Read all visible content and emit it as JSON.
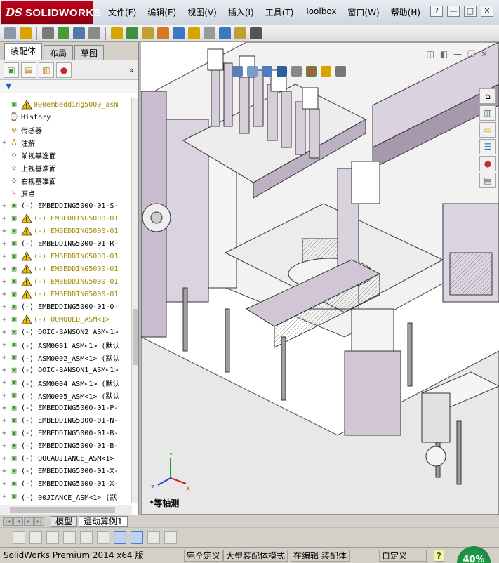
{
  "app": {
    "logo_mark": "DS",
    "logo_text": "SOLIDWORKS"
  },
  "menu": [
    "文件(F)",
    "编辑(E)",
    "视图(V)",
    "插入(I)",
    "工具(T)",
    "Toolbox",
    "窗口(W)",
    "帮助(H)"
  ],
  "window_controls": {
    "help": "?",
    "min": "—",
    "max": "□",
    "close": "✕"
  },
  "panel": {
    "tabs": [
      "装配体",
      "布局",
      "草图"
    ],
    "active_tab": "装配体",
    "filter_icon": "▼"
  },
  "tree": [
    {
      "exp": "",
      "icon": "assembly",
      "warn": true,
      "label": "000embedding5000_asm",
      "yellow": true
    },
    {
      "exp": "",
      "icon": "history",
      "warn": false,
      "label": "History",
      "yellow": false
    },
    {
      "exp": "",
      "icon": "sensor",
      "warn": false,
      "label": "传感器",
      "yellow": false
    },
    {
      "exp": "+",
      "icon": "annotation",
      "warn": false,
      "label": "注解",
      "yellow": false
    },
    {
      "exp": "",
      "icon": "plane",
      "warn": false,
      "label": "前视基准面",
      "yellow": false
    },
    {
      "exp": "",
      "icon": "plane",
      "warn": false,
      "label": "上视基准面",
      "yellow": false
    },
    {
      "exp": "",
      "icon": "plane",
      "warn": false,
      "label": "右视基准面",
      "yellow": false
    },
    {
      "exp": "",
      "icon": "origin",
      "warn": false,
      "label": "原点",
      "yellow": false
    },
    {
      "exp": "+",
      "icon": "assembly",
      "warn": false,
      "label": "(-) EMBEDDING5000-01-S-",
      "yellow": false
    },
    {
      "exp": "+",
      "icon": "assembly",
      "warn": true,
      "label": "(-) EMBEDDING5000-01",
      "yellow": true
    },
    {
      "exp": "+",
      "icon": "assembly",
      "warn": true,
      "label": "(-) EMBEDDING5000-01",
      "yellow": true
    },
    {
      "exp": "+",
      "icon": "assembly",
      "warn": false,
      "label": "(-) EMBEDDING5000-01-R-",
      "yellow": false
    },
    {
      "exp": "+",
      "icon": "assembly",
      "warn": true,
      "label": "(-) EMBEDDING5000-01",
      "yellow": true
    },
    {
      "exp": "+",
      "icon": "assembly",
      "warn": true,
      "label": "(-) EMBEDDING5000-01",
      "yellow": true
    },
    {
      "exp": "+",
      "icon": "assembly",
      "warn": true,
      "label": "(-) EMBEDDING5000-01",
      "yellow": true
    },
    {
      "exp": "+",
      "icon": "assembly",
      "warn": true,
      "label": "(-) EMBEDDING5000-01",
      "yellow": true
    },
    {
      "exp": "+",
      "icon": "assembly",
      "warn": false,
      "label": "(-) EMBEDDING5000-01-0-",
      "yellow": false
    },
    {
      "exp": "+",
      "icon": "assembly",
      "warn": true,
      "label": "(-) 00MOULD_ASM<1>",
      "yellow": true
    },
    {
      "exp": "+",
      "icon": "assembly",
      "warn": false,
      "label": "(-) OOIC-BANSON2_ASM<1>",
      "yellow": false
    },
    {
      "exp": "+",
      "icon": "assembly",
      "warn": false,
      "label": "(-) ASM0001_ASM<1> (默认",
      "yellow": false
    },
    {
      "exp": "+",
      "icon": "assembly",
      "warn": false,
      "label": "(-) ASM0002_ASM<1> (默认",
      "yellow": false
    },
    {
      "exp": "+",
      "icon": "assembly",
      "warn": false,
      "label": "(-) OOIC-BANSON1_ASM<1>",
      "yellow": false
    },
    {
      "exp": "+",
      "icon": "assembly",
      "warn": false,
      "label": "(-) ASM0004_ASM<1> (默认",
      "yellow": false
    },
    {
      "exp": "+",
      "icon": "assembly",
      "warn": false,
      "label": "(-) ASM0005_ASM<1> (默认",
      "yellow": false
    },
    {
      "exp": "+",
      "icon": "assembly",
      "warn": false,
      "label": "(-) EMBEDDING5000-01-P-",
      "yellow": false
    },
    {
      "exp": "+",
      "icon": "assembly",
      "warn": false,
      "label": "(-) EMBEDDING5000-01-N-",
      "yellow": false
    },
    {
      "exp": "+",
      "icon": "assembly",
      "warn": false,
      "label": "(-) EMBEDDING5000-01-B-",
      "yellow": false
    },
    {
      "exp": "+",
      "icon": "assembly",
      "warn": false,
      "label": "(-) EMBEDDING5000-01-B-",
      "yellow": false
    },
    {
      "exp": "+",
      "icon": "assembly",
      "warn": false,
      "label": "(-) OOCAOJIANCE_ASM<1>",
      "yellow": false
    },
    {
      "exp": "+",
      "icon": "assembly",
      "warn": false,
      "label": "(-) EMBEDDING5000-01-X-",
      "yellow": false
    },
    {
      "exp": "+",
      "icon": "assembly",
      "warn": false,
      "label": "(-) EMBEDDING5000-01-X-",
      "yellow": false
    },
    {
      "exp": "+",
      "icon": "assembly",
      "warn": false,
      "label": "(-) 00JIANCE_ASM<1> (默",
      "yellow": false
    }
  ],
  "viewport": {
    "view_label": "*等轴测",
    "triad": {
      "x": "X",
      "y": "Y",
      "z": "Z"
    }
  },
  "bottom_tabs": [
    "模型",
    "运动算例1"
  ],
  "active_bottom_tab": "运动算例1",
  "status": {
    "version": "SolidWorks Premium 2014 x64 版",
    "fully_defined": "完全定义",
    "large_assembly": "大型装配体模式",
    "editing": "在编辑 装配体",
    "units": "自定义",
    "help": "?",
    "zoom": "40%"
  },
  "colors": {
    "brand": "#c0001a",
    "warning": "#f2c200",
    "tree_yellow": "#a08a00",
    "machine_frame": "#b8a8c0",
    "zoom_badge": "#1d9446"
  }
}
